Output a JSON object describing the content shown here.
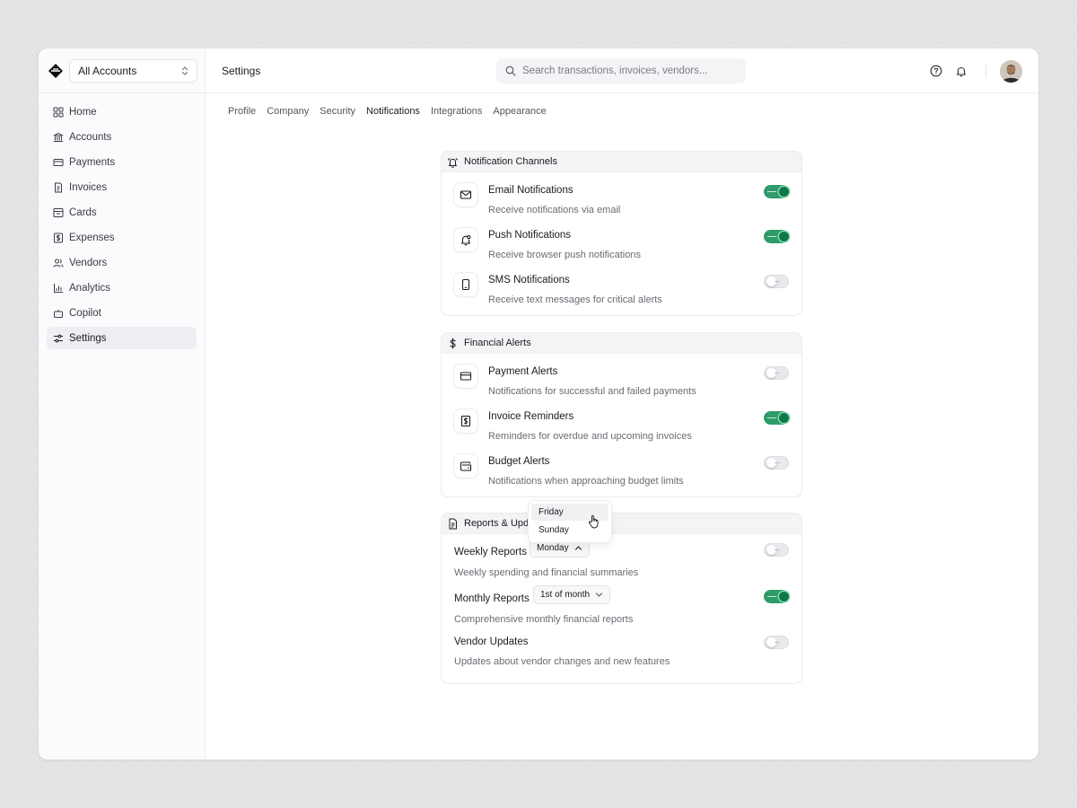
{
  "sidebar": {
    "account": "All Accounts",
    "items": [
      {
        "label": "Home",
        "icon": "grid-icon"
      },
      {
        "label": "Accounts",
        "icon": "bank-icon"
      },
      {
        "label": "Payments",
        "icon": "credit-card-icon"
      },
      {
        "label": "Invoices",
        "icon": "invoice-icon"
      },
      {
        "label": "Cards",
        "icon": "card-box-icon"
      },
      {
        "label": "Expenses",
        "icon": "dollar-receipt-icon"
      },
      {
        "label": "Vendors",
        "icon": "users-icon"
      },
      {
        "label": "Analytics",
        "icon": "bar-chart-icon"
      },
      {
        "label": "Copilot",
        "icon": "bot-icon"
      },
      {
        "label": "Settings",
        "icon": "sliders-icon",
        "active": true
      }
    ]
  },
  "header": {
    "title": "Settings",
    "search_placeholder": "Search transactions, invoices, vendors..."
  },
  "tabs": [
    "Profile",
    "Company",
    "Security",
    "Notifications",
    "Integrations",
    "Appearance"
  ],
  "active_tab": "Notifications",
  "channels": {
    "title": "Notification Channels",
    "items": [
      {
        "title": "Email Notifications",
        "desc": "Receive notifications via email",
        "enabled": true
      },
      {
        "title": "Push Notifications",
        "desc": "Receive browser push notifications",
        "enabled": true
      },
      {
        "title": "SMS Notifications",
        "desc": "Receive text messages for critical alerts",
        "enabled": false
      }
    ]
  },
  "financial": {
    "title": "Financial Alerts",
    "items": [
      {
        "title": "Payment Alerts",
        "desc": "Notifications for successful and failed payments",
        "enabled": false
      },
      {
        "title": "Invoice Reminders",
        "desc": "Reminders for overdue and upcoming invoices",
        "enabled": true
      },
      {
        "title": "Budget Alerts",
        "desc": "Notifications when approaching budget limits",
        "enabled": false
      }
    ]
  },
  "reports": {
    "title": "Reports & Updates",
    "visible_title": "Reports & Updat",
    "items": [
      {
        "title": "Weekly Reports",
        "select": "Monday",
        "desc": "Weekly spending and financial summaries",
        "enabled": false
      },
      {
        "title": "Monthly Reports",
        "select": "1st of month",
        "desc": "Comprehensive monthly financial reports",
        "enabled": true
      },
      {
        "title": "Vendor Updates",
        "desc": "Updates about vendor changes and new features",
        "enabled": false
      }
    ]
  },
  "dropdown": {
    "options": [
      "Friday",
      "Sunday"
    ],
    "hovered": "Friday"
  },
  "colors": {
    "toggle_on": "#0b7a45",
    "toggle_track_on": "#2f9a6a"
  }
}
